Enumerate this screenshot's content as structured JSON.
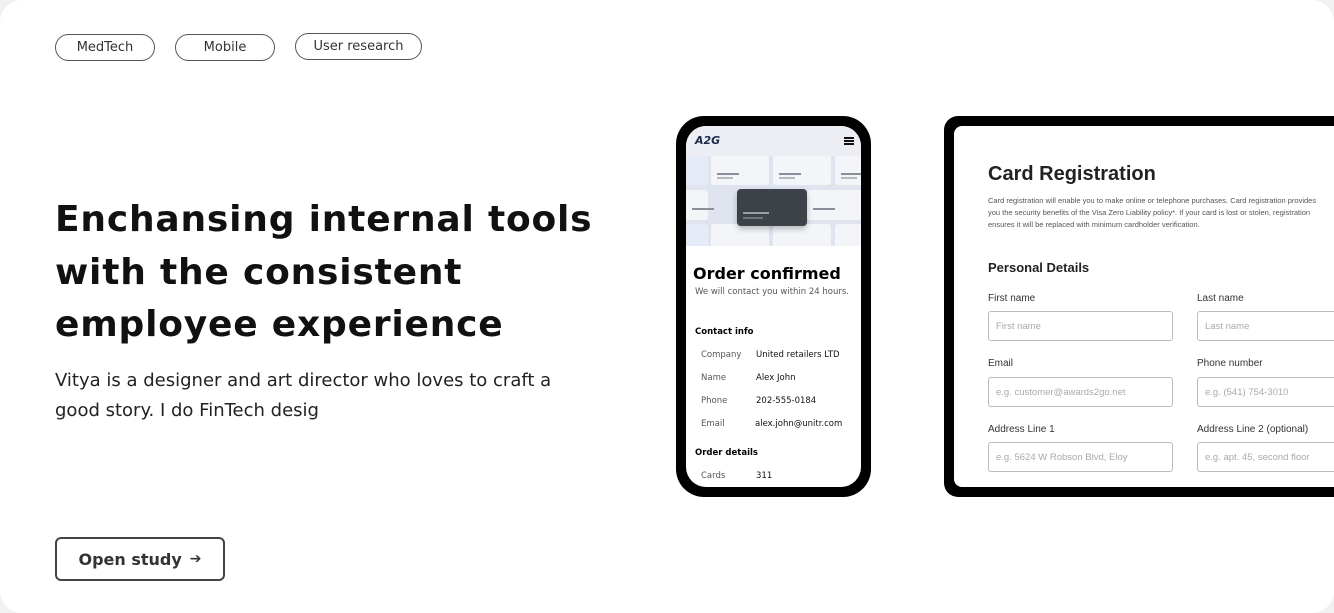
{
  "tags": [
    "MedTech",
    "Mobile",
    "User research"
  ],
  "hero": {
    "title_line1": "Enchansing internal tools",
    "title_line2": "with the consistent",
    "title_line3": "employee experience",
    "description": "Vitya is a designer and art director who loves to craft a good story. I do FinTech desig"
  },
  "cta": {
    "label": "Open study",
    "icon": "arrow-right-icon"
  },
  "phone": {
    "logo": "A2G",
    "title": "Order confirmed",
    "subtitle": "We will contact you within 24 hours.",
    "contact_heading": "Contact info",
    "contact": [
      {
        "label": "Company",
        "value": "United retailers LTD"
      },
      {
        "label": "Name",
        "value": "Alex John"
      },
      {
        "label": "Phone",
        "value": "202-555-0184"
      },
      {
        "label": "Email",
        "value": "alex.john@unitr.com"
      }
    ],
    "order_heading": "Order details",
    "order": [
      {
        "label": "Cards",
        "value": "311"
      }
    ]
  },
  "desktop": {
    "title": "Card Registration",
    "paragraph": "Card registration will enable you to make online or telephone purchases. Card registration provides you the security benefits of the Visa Zero Liability policy*. If your card is lost or stolen, registration ensures it will be replaced with minimum cardholder verification.",
    "section": "Personal Details",
    "fields": [
      {
        "label": "First name",
        "placeholder": "First name"
      },
      {
        "label": "Last name",
        "placeholder": "Last name"
      },
      {
        "label": "Email",
        "placeholder": "e.g. customer@awards2go.net"
      },
      {
        "label": "Phone number",
        "placeholder": "e.g. (541) 754-3010"
      },
      {
        "label": "Address Line 1",
        "placeholder": "e.g. 5624 W Robson Blvd, Eloy"
      },
      {
        "label": "Address Line 2 (optional)",
        "placeholder": "e.g. apt. 45, second floor"
      }
    ]
  }
}
